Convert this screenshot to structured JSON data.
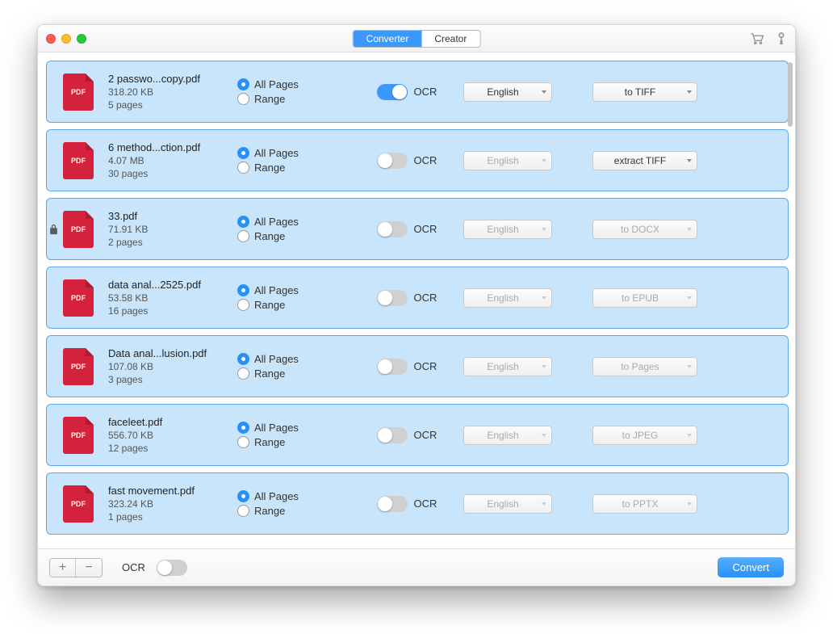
{
  "tabs": {
    "converter": "Converter",
    "creator": "Creator",
    "active": "converter"
  },
  "labels": {
    "allPages": "All Pages",
    "range": "Range",
    "ocr": "OCR",
    "pdfBadge": "PDF",
    "convert": "Convert"
  },
  "footer": {
    "ocrLabel": "OCR"
  },
  "files": [
    {
      "name": "2 passwo...copy.pdf",
      "size": "318.20 KB",
      "pages": "5 pages",
      "locked": false,
      "ocrOn": true,
      "lang": "English",
      "langEnabled": true,
      "format": "to TIFF",
      "formatEnabled": true
    },
    {
      "name": "6 method...ction.pdf",
      "size": "4.07 MB",
      "pages": "30 pages",
      "locked": false,
      "ocrOn": false,
      "lang": "English",
      "langEnabled": false,
      "format": "extract TIFF",
      "formatEnabled": true
    },
    {
      "name": "33.pdf",
      "size": "71.91 KB",
      "pages": "2 pages",
      "locked": true,
      "ocrOn": false,
      "lang": "English",
      "langEnabled": false,
      "format": "to DOCX",
      "formatEnabled": false
    },
    {
      "name": "data anal...2525.pdf",
      "size": "53.58 KB",
      "pages": "16 pages",
      "locked": false,
      "ocrOn": false,
      "lang": "English",
      "langEnabled": false,
      "format": "to EPUB",
      "formatEnabled": false
    },
    {
      "name": "Data anal...lusion.pdf",
      "size": "107.08 KB",
      "pages": "3 pages",
      "locked": false,
      "ocrOn": false,
      "lang": "English",
      "langEnabled": false,
      "format": "to Pages",
      "formatEnabled": false
    },
    {
      "name": "faceleet.pdf",
      "size": "556.70 KB",
      "pages": "12 pages",
      "locked": false,
      "ocrOn": false,
      "lang": "English",
      "langEnabled": false,
      "format": "to JPEG",
      "formatEnabled": false
    },
    {
      "name": "fast movement.pdf",
      "size": "323.24 KB",
      "pages": "1 pages",
      "locked": false,
      "ocrOn": false,
      "lang": "English",
      "langEnabled": false,
      "format": "to PPTX",
      "formatEnabled": false
    }
  ]
}
